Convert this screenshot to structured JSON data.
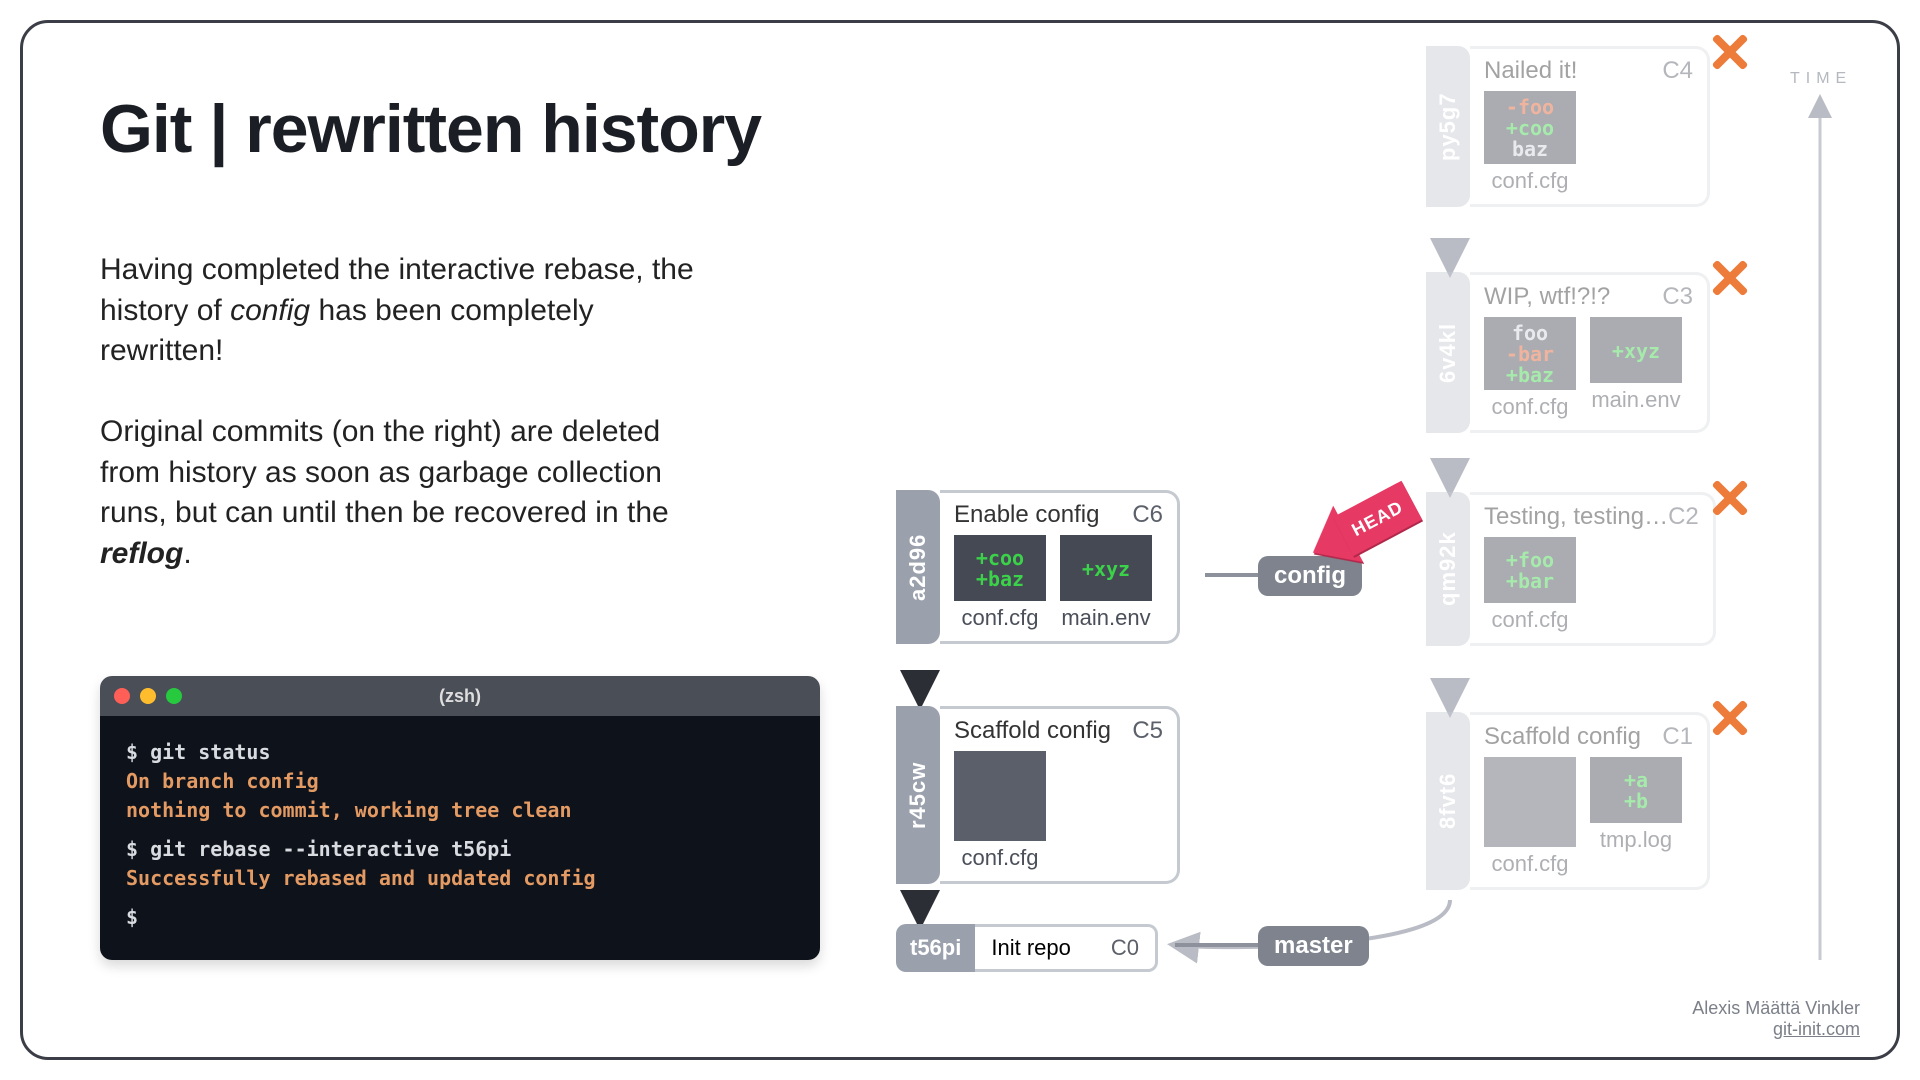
{
  "title": "Git | rewritten history",
  "para1_a": "Having completed the interactive rebase, the history of ",
  "para1_b": "config",
  "para1_c": " has been completely rewritten!",
  "para2_a": "Original commits (on the right) are deleted from history as soon as garbage collection runs, but can until then be recovered in the ",
  "para2_b": "reflog",
  "para2_c": ".",
  "terminal": {
    "title": "(zsh)",
    "l1": "$ git status",
    "l2": "On branch config",
    "l3": "nothing to commit, working tree clean",
    "l4": "$ git rebase --interactive t56pi",
    "l5": "Successfully rebased and updated config",
    "l6": "$"
  },
  "branches": {
    "config": "config",
    "master": "master",
    "head": "HEAD"
  },
  "time_label": "TIME",
  "credit": {
    "name": "Alexis Määttä Vinkler",
    "url": "git-init.com"
  },
  "commits": {
    "c6": {
      "hash": "a2d96",
      "msg": "Enable config",
      "label": "C6",
      "files": [
        {
          "name": "conf.cfg",
          "lines": [
            {
              "t": "add",
              "s": "+coo"
            },
            {
              "t": "add",
              "s": "+baz"
            }
          ]
        },
        {
          "name": "main.env",
          "lines": [
            {
              "t": "add",
              "s": "+xyz"
            }
          ]
        }
      ]
    },
    "c5": {
      "hash": "r45cw",
      "msg": "Scaffold config",
      "label": "C5",
      "files": [
        {
          "name": "conf.cfg",
          "empty": true
        }
      ]
    },
    "c0": {
      "hash": "t56pi",
      "msg": "Init repo",
      "label": "C0"
    },
    "c4": {
      "hash": "py5g7",
      "msg": "Nailed it!",
      "label": "C4",
      "files": [
        {
          "name": "conf.cfg",
          "lines": [
            {
              "t": "del",
              "s": "-foo"
            },
            {
              "t": "add",
              "s": "+coo"
            },
            {
              "t": "ctx",
              "s": "baz"
            }
          ]
        }
      ]
    },
    "c3": {
      "hash": "6v4kl",
      "msg": "WIP, wtf!?!?",
      "label": "C3",
      "files": [
        {
          "name": "conf.cfg",
          "lines": [
            {
              "t": "ctx",
              "s": "foo"
            },
            {
              "t": "del",
              "s": "-bar"
            },
            {
              "t": "add",
              "s": "+baz"
            }
          ]
        },
        {
          "name": "main.env",
          "lines": [
            {
              "t": "add",
              "s": "+xyz"
            }
          ]
        }
      ]
    },
    "c2": {
      "hash": "qm92k",
      "msg": "Testing, testing…",
      "label": "C2",
      "files": [
        {
          "name": "conf.cfg",
          "lines": [
            {
              "t": "add",
              "s": "+foo"
            },
            {
              "t": "add",
              "s": "+bar"
            }
          ]
        }
      ]
    },
    "c1": {
      "hash": "8fvt6",
      "msg": "Scaffold config",
      "label": "C1",
      "files": [
        {
          "name": "conf.cfg",
          "empty": true
        },
        {
          "name": "tmp.log",
          "lines": [
            {
              "t": "add",
              "s": "+a"
            },
            {
              "t": "add",
              "s": "+b"
            }
          ]
        }
      ]
    }
  }
}
